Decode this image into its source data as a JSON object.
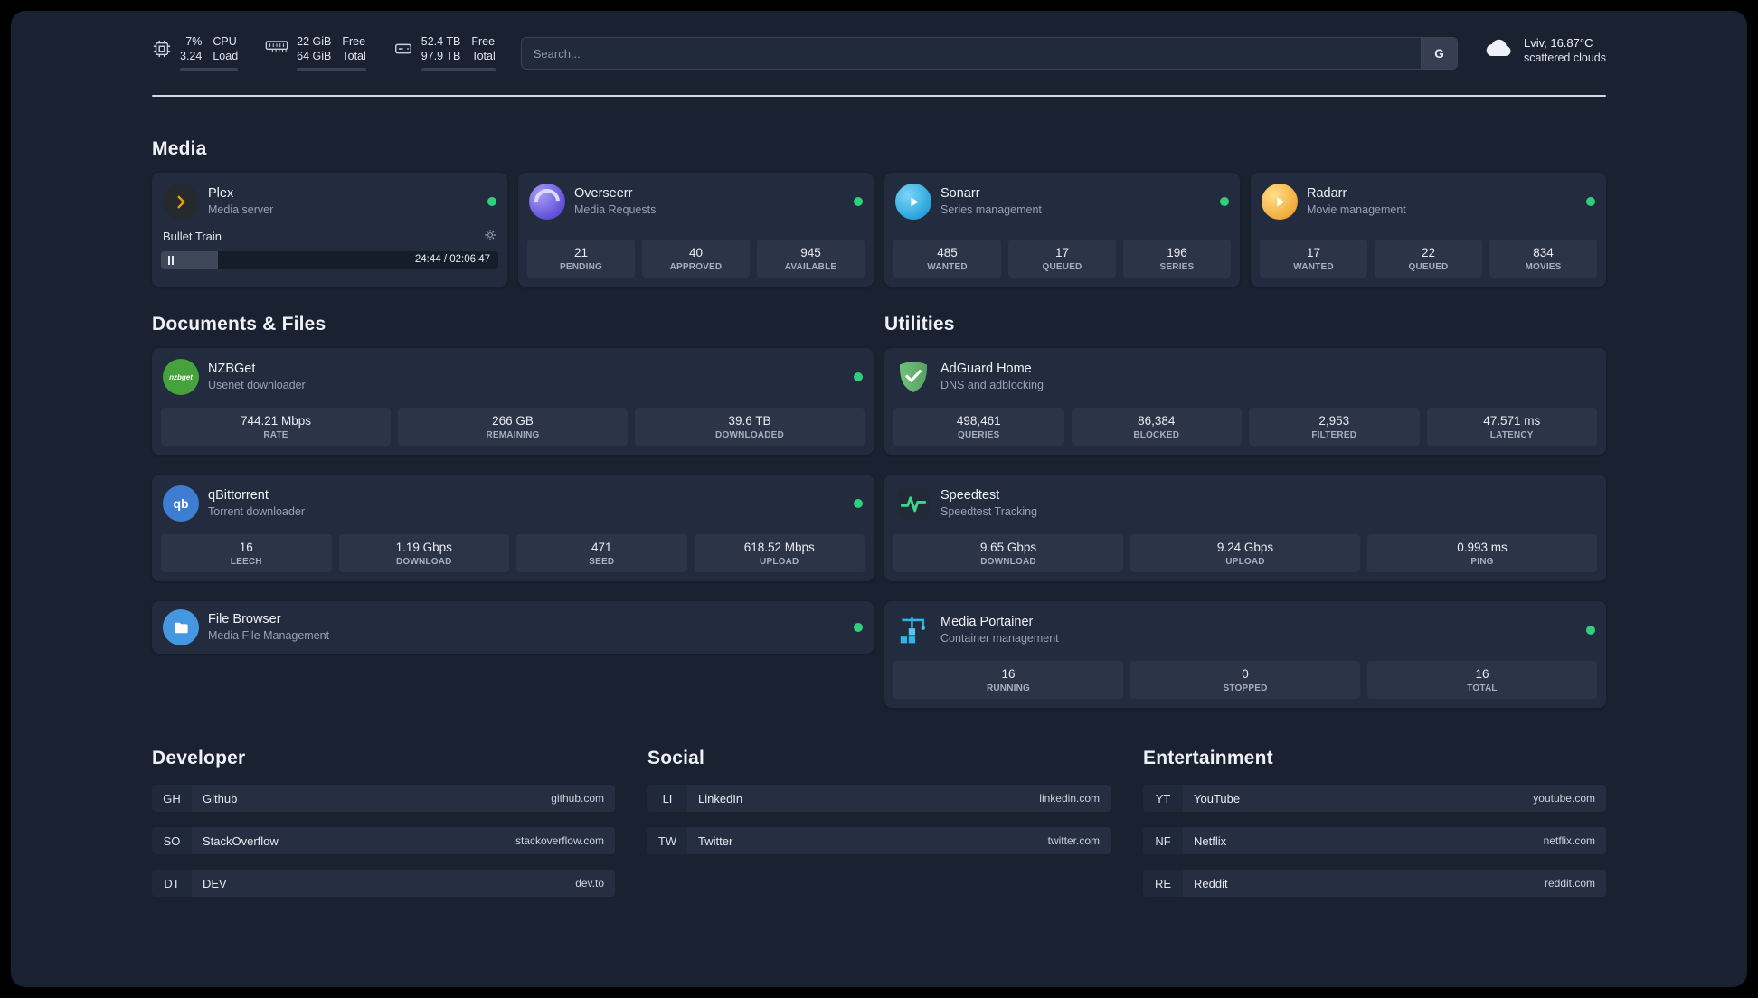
{
  "topbar": {
    "cpu": {
      "value1": "7%",
      "label1": "CPU",
      "value2": "3.24",
      "label2": "Load"
    },
    "memory": {
      "value1": "22 GiB",
      "label1": "Free",
      "value2": "64 GiB",
      "label2": "Total"
    },
    "disk": {
      "value1": "52.4 TB",
      "label1": "Free",
      "value2": "97.9 TB",
      "label2": "Total"
    },
    "search": {
      "placeholder": "Search...",
      "provider": "G"
    },
    "weather": {
      "location": "Lviv, 16.87°C",
      "condition": "scattered clouds"
    }
  },
  "sections": {
    "media": "Media",
    "documents": "Documents & Files",
    "utilities": "Utilities",
    "developer": "Developer",
    "social": "Social",
    "entertainment": "Entertainment"
  },
  "services": {
    "plex": {
      "name": "Plex",
      "desc": "Media server",
      "now_playing": "Bullet Train",
      "time": "24:44 / 02:06:47"
    },
    "overseerr": {
      "name": "Overseerr",
      "desc": "Media Requests",
      "stats": [
        {
          "value": "21",
          "label": "PENDING"
        },
        {
          "value": "40",
          "label": "APPROVED"
        },
        {
          "value": "945",
          "label": "AVAILABLE"
        }
      ]
    },
    "sonarr": {
      "name": "Sonarr",
      "desc": "Series management",
      "stats": [
        {
          "value": "485",
          "label": "WANTED"
        },
        {
          "value": "17",
          "label": "QUEUED"
        },
        {
          "value": "196",
          "label": "SERIES"
        }
      ]
    },
    "radarr": {
      "name": "Radarr",
      "desc": "Movie management",
      "stats": [
        {
          "value": "17",
          "label": "WANTED"
        },
        {
          "value": "22",
          "label": "QUEUED"
        },
        {
          "value": "834",
          "label": "MOVIES"
        }
      ]
    },
    "nzbget": {
      "name": "NZBGet",
      "desc": "Usenet downloader",
      "icon_text": "nzbget",
      "stats": [
        {
          "value": "744.21 Mbps",
          "label": "RATE"
        },
        {
          "value": "266 GB",
          "label": "REMAINING"
        },
        {
          "value": "39.6 TB",
          "label": "DOWNLOADED"
        }
      ]
    },
    "qbittorrent": {
      "name": "qBittorrent",
      "desc": "Torrent downloader",
      "icon_text": "qb",
      "stats": [
        {
          "value": "16",
          "label": "LEECH"
        },
        {
          "value": "1.19 Gbps",
          "label": "DOWNLOAD"
        },
        {
          "value": "471",
          "label": "SEED"
        },
        {
          "value": "618.52 Mbps",
          "label": "UPLOAD"
        }
      ]
    },
    "filebrowser": {
      "name": "File Browser",
      "desc": "Media File Management"
    },
    "adguard": {
      "name": "AdGuard Home",
      "desc": "DNS and adblocking",
      "stats": [
        {
          "value": "498,461",
          "label": "QUERIES"
        },
        {
          "value": "86,384",
          "label": "BLOCKED"
        },
        {
          "value": "2,953",
          "label": "FILTERED"
        },
        {
          "value": "47.571 ms",
          "label": "LATENCY"
        }
      ]
    },
    "speedtest": {
      "name": "Speedtest",
      "desc": "Speedtest Tracking",
      "stats": [
        {
          "value": "9.65 Gbps",
          "label": "DOWNLOAD"
        },
        {
          "value": "9.24 Gbps",
          "label": "UPLOAD"
        },
        {
          "value": "0.993 ms",
          "label": "PING"
        }
      ]
    },
    "portainer": {
      "name": "Media Portainer",
      "desc": "Container management",
      "stats": [
        {
          "value": "16",
          "label": "RUNNING"
        },
        {
          "value": "0",
          "label": "STOPPED"
        },
        {
          "value": "16",
          "label": "TOTAL"
        }
      ]
    }
  },
  "bookmarks": {
    "developer": [
      {
        "abbr": "GH",
        "name": "Github",
        "url": "github.com"
      },
      {
        "abbr": "SO",
        "name": "StackOverflow",
        "url": "stackoverflow.com"
      },
      {
        "abbr": "DT",
        "name": "DEV",
        "url": "dev.to"
      }
    ],
    "social": [
      {
        "abbr": "LI",
        "name": "LinkedIn",
        "url": "linkedin.com"
      },
      {
        "abbr": "TW",
        "name": "Twitter",
        "url": "twitter.com"
      }
    ],
    "entertainment": [
      {
        "abbr": "YT",
        "name": "YouTube",
        "url": "youtube.com"
      },
      {
        "abbr": "NF",
        "name": "Netflix",
        "url": "netflix.com"
      },
      {
        "abbr": "RE",
        "name": "Reddit",
        "url": "reddit.com"
      }
    ]
  }
}
